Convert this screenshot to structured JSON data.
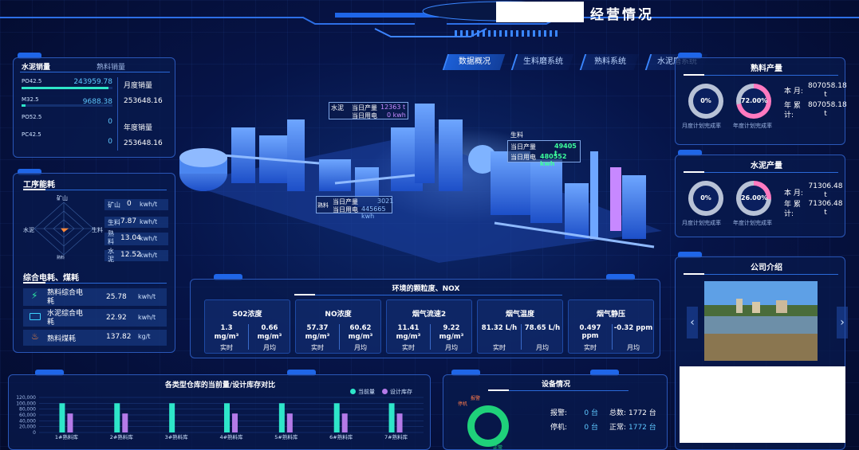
{
  "header": {
    "title": "经营情况"
  },
  "tabs": [
    {
      "label": "数据概况",
      "active": true
    },
    {
      "label": "生料磨系统",
      "active": false
    },
    {
      "label": "熟料系统",
      "active": false
    },
    {
      "label": "水泥磨系统",
      "active": false
    }
  ],
  "sales": {
    "tab_active": "水泥销量",
    "tab_other": "熟料销量",
    "items": [
      {
        "name": "PO42.5",
        "value": "243959.78",
        "bar": 0.96
      },
      {
        "name": "M32.5",
        "value": "9688.38",
        "bar": 0.04
      },
      {
        "name": "PO52.5",
        "value": "0",
        "bar": 0
      },
      {
        "name": "PC42.5",
        "value": "0",
        "bar": 0
      }
    ],
    "monthly_label": "月度销量",
    "monthly_value": "253648.16",
    "yearly_label": "年度销量",
    "yearly_value": "253648.16"
  },
  "process_energy": {
    "title": "工序能耗",
    "radar_axes": [
      "矿山",
      "生料",
      "熟料",
      "水泥"
    ],
    "rows": [
      {
        "name": "矿山",
        "value": "0",
        "unit": "kwh/t"
      },
      {
        "name": "生料",
        "value": "7.87",
        "unit": "kwh/t"
      },
      {
        "name": "熟料",
        "value": "13.04",
        "unit": "kwh/t"
      },
      {
        "name": "水泥",
        "value": "12.52",
        "unit": "kwh/t"
      }
    ]
  },
  "power_coal": {
    "title": "综合电耗、煤耗",
    "rows": [
      {
        "name": "熟料综合电耗",
        "value": "25.78",
        "unit": "kwh/t",
        "icon": "lightning-icon"
      },
      {
        "name": "水泥综合电耗",
        "value": "22.92",
        "unit": "kwh/t",
        "icon": "battery-icon"
      },
      {
        "name": "熟料煤耗",
        "value": "137.82",
        "unit": "kg/t",
        "icon": "flame-icon"
      }
    ]
  },
  "plant": {
    "cement_label": "水泥",
    "cement_prod_label": "当日产量",
    "cement_prod_value": "12363 t",
    "cement_power_label": "当日用电",
    "cement_power_value": "0 kwh",
    "raw_label": "生料",
    "raw_prod_label": "当日产量",
    "raw_prod_value": "49405 t",
    "raw_power_label": "当日用电",
    "raw_power_value": "480552 kwh",
    "clinker_label": "熟料",
    "clinker_prod_label": "当日产量",
    "clinker_prod_value": "3021",
    "clinker_power_label": "当日用电",
    "clinker_power_value": "445665 kwh"
  },
  "clinker_output": {
    "title": "熟料产量",
    "plan_month_pct": "0%",
    "plan_year_pct": "72.00%",
    "plan_month_frac": 0,
    "plan_year_frac": 0.72,
    "month_caption": "月度计划完成率",
    "year_caption": "年度计划完成率",
    "this_month_label": "本 月:",
    "this_month_value": "807058.18 t",
    "year_cum_label": "年 累 计:",
    "year_cum_value": "807058.18 t"
  },
  "cement_output": {
    "title": "水泥产量",
    "plan_month_pct": "0%",
    "plan_year_pct": "26.00%",
    "plan_month_frac": 0,
    "plan_year_frac": 0.26,
    "month_caption": "月度计划完成率",
    "year_caption": "年度计划完成率",
    "this_month_label": "本 月:",
    "this_month_value": "71306.48 t",
    "year_cum_label": "年 累 计:",
    "year_cum_value": "71306.48 t"
  },
  "company": {
    "title": "公司介绍"
  },
  "env": {
    "title": "环境的颗粒度、NOX",
    "cells": [
      {
        "name": "S02浓度",
        "a_val": "1.3",
        "a_unit": "mg/m³",
        "a_lab": "实时",
        "b_val": "0.66",
        "b_unit": "mg/m³",
        "b_lab": "月均"
      },
      {
        "name": "NO浓度",
        "a_val": "57.37",
        "a_unit": "mg/m³",
        "a_lab": "实时",
        "b_val": "60.62",
        "b_unit": "mg/m³",
        "b_lab": "月均"
      },
      {
        "name": "烟气流速2",
        "a_val": "11.41",
        "a_unit": "mg/m³",
        "a_lab": "实时",
        "b_val": "9.22",
        "b_unit": "mg/m³",
        "b_lab": "月均"
      },
      {
        "name": "烟气温度",
        "a_val": "81.32 L/h",
        "a_unit": "",
        "a_lab": "实时",
        "b_val": "78.65 L/h",
        "b_unit": "",
        "b_lab": "月均"
      },
      {
        "name": "烟气静压",
        "a_val": "0.497 ppm",
        "a_unit": "",
        "a_lab": "实时",
        "b_val": "-0.32 ppm",
        "b_unit": "",
        "b_lab": "月均"
      }
    ]
  },
  "warehouse": {
    "title": "各类型仓库的当前量/设计库存对比",
    "legend": [
      "当前量",
      "设计库存"
    ]
  },
  "chart_data": {
    "type": "bar",
    "title": "各类型仓库的当前量/设计库存对比",
    "categories": [
      "1#熟料库",
      "2#熟料库",
      "3#熟料库",
      "4#熟料库",
      "5#熟料库",
      "6#熟料库",
      "7#熟料库"
    ],
    "series": [
      {
        "name": "当前量",
        "values": [
          100000,
          100000,
          100000,
          100000,
          100000,
          100000,
          100000
        ]
      },
      {
        "name": "设计库存",
        "values": [
          65000,
          65000,
          0,
          65000,
          65000,
          65000,
          65000
        ]
      }
    ],
    "yticks": [
      "0",
      "20,000",
      "40,000",
      "60,000",
      "80,000",
      "100,000",
      "120,000"
    ],
    "ylim": [
      0,
      120000
    ],
    "colors": [
      "#2ee6c9",
      "#b57ae8"
    ]
  },
  "equipment": {
    "title": "设备情况",
    "ring_labels": [
      "报警",
      "停机",
      "正常"
    ],
    "alarm_label": "报警:",
    "alarm_value": "0 台",
    "stop_label": "停机:",
    "stop_value": "0 台",
    "total_label": "总数:",
    "total_value": "1772 台",
    "normal_label": "正常:",
    "normal_value": "1772 台"
  }
}
